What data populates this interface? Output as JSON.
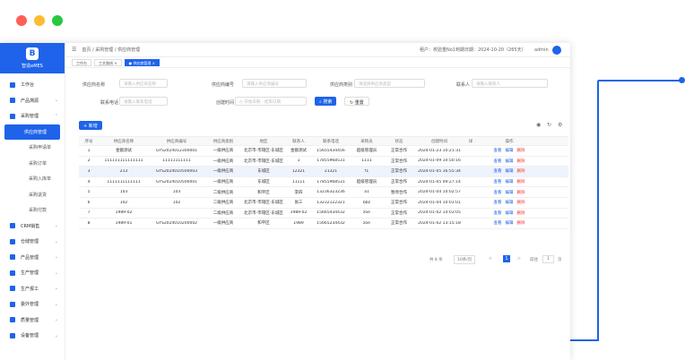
{
  "brand": {
    "name": "智造eMES"
  },
  "menu": [
    {
      "label": "工作台",
      "type": "top"
    },
    {
      "label": "产品溯源",
      "type": "top",
      "arrow": "⌄"
    },
    {
      "label": "采购管理",
      "type": "top",
      "arrow": "⌃"
    },
    {
      "label": "供应商管理",
      "type": "active"
    },
    {
      "label": "采购申请单",
      "type": "sub"
    },
    {
      "label": "采购订单",
      "type": "sub"
    },
    {
      "label": "采购入库单",
      "type": "sub"
    },
    {
      "label": "采购退货",
      "type": "sub"
    },
    {
      "label": "采购付款",
      "type": "sub"
    },
    {
      "label": "CRM销售",
      "type": "top",
      "arrow": "⌄"
    },
    {
      "label": "仓储管理",
      "type": "top",
      "arrow": "⌄"
    },
    {
      "label": "产品管理",
      "type": "top",
      "arrow": "⌄"
    },
    {
      "label": "生产管理",
      "type": "top",
      "arrow": "⌄"
    },
    {
      "label": "生产报工",
      "type": "top",
      "arrow": "⌄"
    },
    {
      "label": "委外管理",
      "type": "top",
      "arrow": "⌄"
    },
    {
      "label": "质量管理",
      "type": "top",
      "arrow": "⌄"
    },
    {
      "label": "设备管理",
      "type": "top",
      "arrow": "⌄"
    }
  ],
  "breadcrumb": "首页 / 采购管理 / 供应商管理",
  "header": {
    "tenant": "租户：校验重No1",
    "expire": "到期日期：2024-10-20（265天）",
    "user": "admin"
  },
  "tabs": [
    "工作台",
    "工艺路线 ×",
    "● 供应商管理 ×"
  ],
  "filters": {
    "name_label": "供应商名称",
    "name_ph": "请输入供应商名称",
    "code_label": "供应商编号",
    "code_ph": "请输入供应商编号",
    "type_label": "供应商类别",
    "type_ph": "请选择供应商类型",
    "contact_label": "联系人",
    "contact_ph": "请输入联系人",
    "phone_label": "联系电话",
    "phone_ph": "请输入联系电话",
    "time_label": "创建时间",
    "start_ph": "开始日期",
    "sep": "-",
    "end_ph": "结束日期",
    "search": "搜索",
    "reset": "重置"
  },
  "add_button": "+ 新增",
  "columns": [
    "序号",
    "供应商名称",
    "供应商编号",
    "供应商类别",
    "地区",
    "联系人",
    "联系电话",
    "采购员",
    "状态",
    "创建时间",
    "详",
    "操作"
  ],
  "rows": [
    [
      "1",
      "金额测试",
      "GYS2024012300001",
      "一级供应商",
      "北京市-市辖区-东城区",
      "金额测试",
      "15655434456",
      "超级管理员",
      "正常合作",
      "2024-01-23 10:21:31"
    ],
    [
      "2",
      "111111111111111",
      "11111111111",
      "一级供应商",
      "北京市-市辖区-东城区",
      "1",
      "17855968531",
      "1111",
      "正常合作",
      "2024-01-09 10:50:16"
    ],
    [
      "3",
      "213",
      "GYS2024010500003",
      "一级供应商",
      "东城区",
      "12321",
      "21321",
      "f1",
      "正常合作",
      "2024-01-05 16:55:34"
    ],
    [
      "4",
      "1111111111111",
      "GYS2024010500001",
      "一级供应商",
      "东城区",
      "11111",
      "17855968531",
      "超级管理员",
      "正常合作",
      "2024-01-05 09:27:14"
    ],
    [
      "5",
      "103",
      "103",
      "二级供应商",
      "和平区",
      "李四",
      "13236323236",
      "a1",
      "暂停合作",
      "2024-01-04 10:02:57"
    ],
    [
      "6",
      "102",
      "102",
      "二级供应商",
      "北京市-市辖区-东城区",
      "张三",
      "13232122321",
      "bbz",
      "正常合作",
      "2024-01-04 10:01:01"
    ],
    [
      "7",
      "1989-02",
      "",
      "二级供应商",
      "北京市-市辖区-东城区",
      "1989-02",
      "15665434432",
      "zoe",
      "正常合作",
      "2024-01-02 14:03:05"
    ],
    [
      "8",
      "1989-01",
      "GYS2024010200002",
      "一级供应商",
      "和平区",
      "1989",
      "15665234432",
      "zoe",
      "正常合作",
      "2024-01-02 13:15:18"
    ]
  ],
  "actions": {
    "view": "查看",
    "edit": "编辑",
    "del": "删除"
  },
  "pager": {
    "total": "共 8 条",
    "size": "10条/页",
    "prev": "<",
    "page": "1",
    "next": ">",
    "goto": "前往",
    "pageno": "1",
    "unit": "页"
  },
  "colors": {
    "primary": "#1f63ea",
    "red": "#ff5f57",
    "yellow": "#febc2e",
    "green": "#28c840"
  }
}
